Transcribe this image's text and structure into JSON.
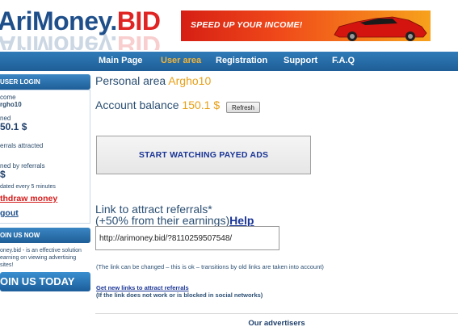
{
  "logo": {
    "part1": "AriMoney.",
    "part2": "BID"
  },
  "banner": {
    "text": "SPEED UP YOUR INCOME!"
  },
  "nav": {
    "items": [
      "Main Page",
      "User area",
      "Registration",
      "Support",
      "F.A.Q"
    ],
    "active": "User area"
  },
  "sidebar": {
    "login_header": "USER LOGIN",
    "welcome_label": "come",
    "username": "rgho10",
    "earned_label": "ned",
    "earned_value": "50.1 $",
    "referrals_label": "errals attracted",
    "by_referrals_label": "ned by referrals",
    "by_referrals_value": "$",
    "update_note": "dated every 5 minutes",
    "withdraw_link": "thdraw money",
    "logout_link": "gout",
    "join_header": "OIN US NOW",
    "join_text_1": "oney.bid - is an effective solution",
    "join_text_2": "earning on viewing advertising",
    "join_text_3": "sites!",
    "join_button": "OIN US TODAY"
  },
  "main": {
    "personal_label": "Personal area",
    "personal_user": "Argho10",
    "balance_label": "Account balance",
    "balance_amount": "150.1",
    "balance_currency": "$",
    "refresh_button": "Refresh",
    "watch_ads_button": "START WATCHING PAYED ADS",
    "referral_title_1": "Link to attract referrals*",
    "referral_title_2": "(+50% from their earnings)",
    "help_link": "Help",
    "referral_link_value": "http://arimoney.bid/?8110259507548/",
    "link_note": "(The link can be changed – this is ok – transitions by old links are taken into account)",
    "new_links_link": "Get new links to attract referrals",
    "new_links_note": "(If the link does not work or is blocked in social networks)",
    "advertisers_title": "Our advertisers"
  },
  "colors": {
    "brand_blue": "#1e4f8a",
    "brand_red": "#e02323",
    "accent_orange": "#e8a018",
    "nav_blue": "#1f5e97"
  }
}
